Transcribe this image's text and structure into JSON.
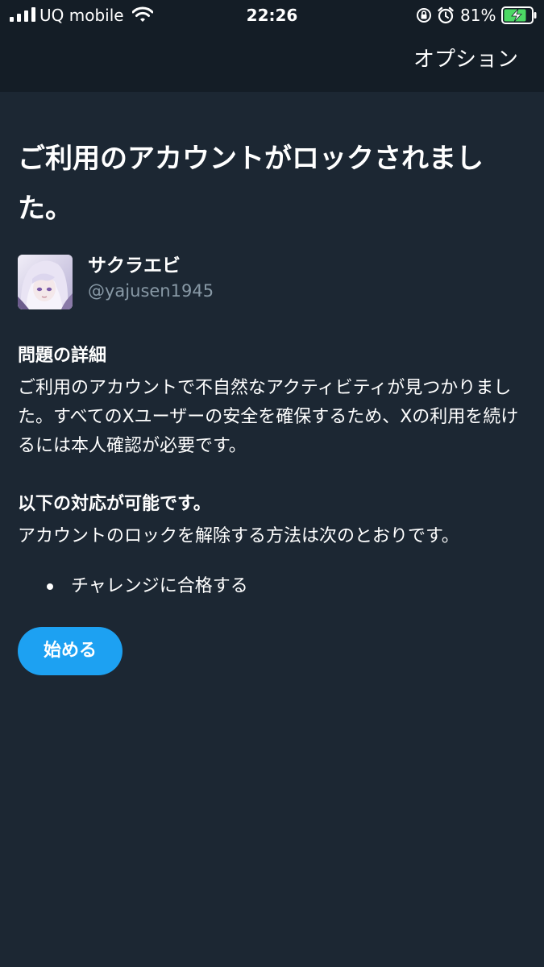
{
  "status_bar": {
    "carrier": "UQ mobile",
    "time": "22:26",
    "battery_percent": "81%",
    "icons": [
      "signal-icon",
      "wifi-icon",
      "orientation-lock-icon",
      "alarm-icon",
      "battery-charging-icon"
    ]
  },
  "nav": {
    "options_label": "オプション"
  },
  "page": {
    "title": "ご利用のアカウントがロックされました。"
  },
  "account": {
    "display_name": "サクラエビ",
    "handle": "@yajusen1945"
  },
  "details": {
    "heading": "問題の詳細",
    "body": "ご利用のアカウントで不自然なアクティビティが見つかりました。すべてのXユーザーの安全を確保するため、Xの利用を続けるには本人確認が必要です。"
  },
  "options": {
    "heading": "以下の対応が可能です。",
    "body": "アカウントのロックを解除する方法は次のとおりです。",
    "items": [
      {
        "label": "チャレンジに合格する"
      }
    ]
  },
  "actions": {
    "start_label": "始める"
  },
  "colors": {
    "background": "#1c2733",
    "topbar": "#141d26",
    "accent": "#1da1f2",
    "muted_text": "#8899a6"
  }
}
